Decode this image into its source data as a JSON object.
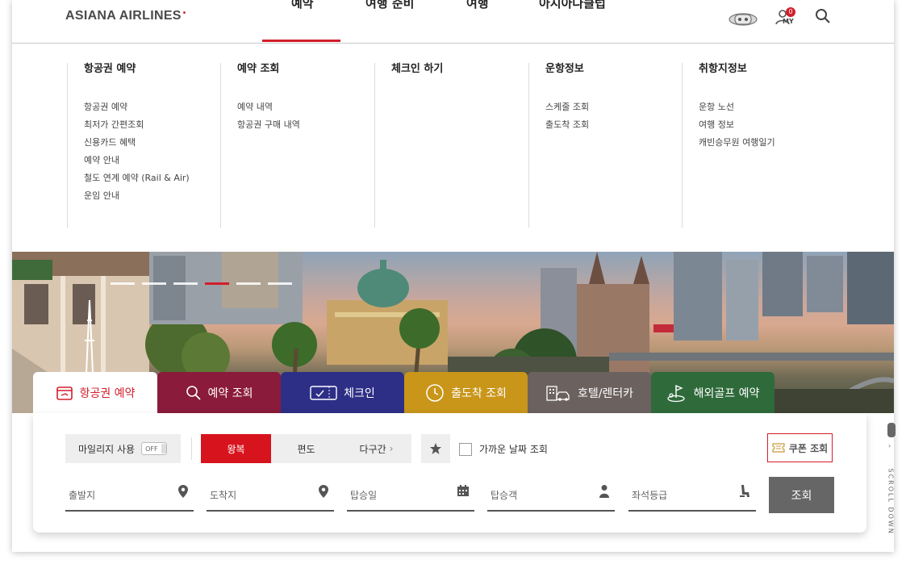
{
  "header": {
    "logo": "ASIANA AIRLINES",
    "logo_mark": "•",
    "nav": [
      "예약",
      "여행 준비",
      "여행",
      "아시아나클럽"
    ],
    "my_badge": "0",
    "my_label": "MY"
  },
  "mega_menu": {
    "columns": [
      {
        "title": "항공권 예약",
        "links": [
          "항공권 예약",
          "최저가 간편조회",
          "신용카드 혜택",
          "예약 안내",
          "철도 연계 예약 (Rail & Air)",
          "운임 안내"
        ]
      },
      {
        "title": "예약 조회",
        "links": [
          "예약 내역",
          "항공권 구매 내역"
        ]
      },
      {
        "title": "체크인 하기",
        "links": []
      },
      {
        "title": "운항정보",
        "links": [
          "스케줄 조회",
          "출도착 조회"
        ]
      },
      {
        "title": "취항지정보",
        "links": [
          "운항 노선",
          "여행 정보",
          "캐빈승무원 여행일기"
        ]
      }
    ]
  },
  "tabs": [
    {
      "label": "항공권 예약",
      "icon": "ticket-icon",
      "color": "#ffffff"
    },
    {
      "label": "예약 조회",
      "icon": "search-icon",
      "color": "#8a1b3a"
    },
    {
      "label": "체크인",
      "icon": "boarding-pass-icon",
      "color": "#2d2f86"
    },
    {
      "label": "출도착 조회",
      "icon": "clock-icon",
      "color": "#c9961a"
    },
    {
      "label": "호텔/렌터카",
      "icon": "hotel-car-icon",
      "color": "#6b6260"
    },
    {
      "label": "해외골프 예약",
      "icon": "golf-icon",
      "color": "#2f6a3b"
    }
  ],
  "search": {
    "mileage_label": "마일리지 사용",
    "mileage_toggle": "OFF",
    "trip_types": [
      "왕복",
      "편도",
      "다구간"
    ],
    "trip_more": "›",
    "nearby_label": "가까운 날짜 조회",
    "coupon_label": "쿠폰 조회",
    "departure": "출발지",
    "arrival": "도착지",
    "date": "탑승일",
    "passenger": "탑승객",
    "seat_class": "좌석등급",
    "submit": "조회"
  },
  "scroll_hint": "SCROLL DOWN",
  "colors": {
    "brand_red": "#d21e2b",
    "button_gray": "#666666"
  }
}
